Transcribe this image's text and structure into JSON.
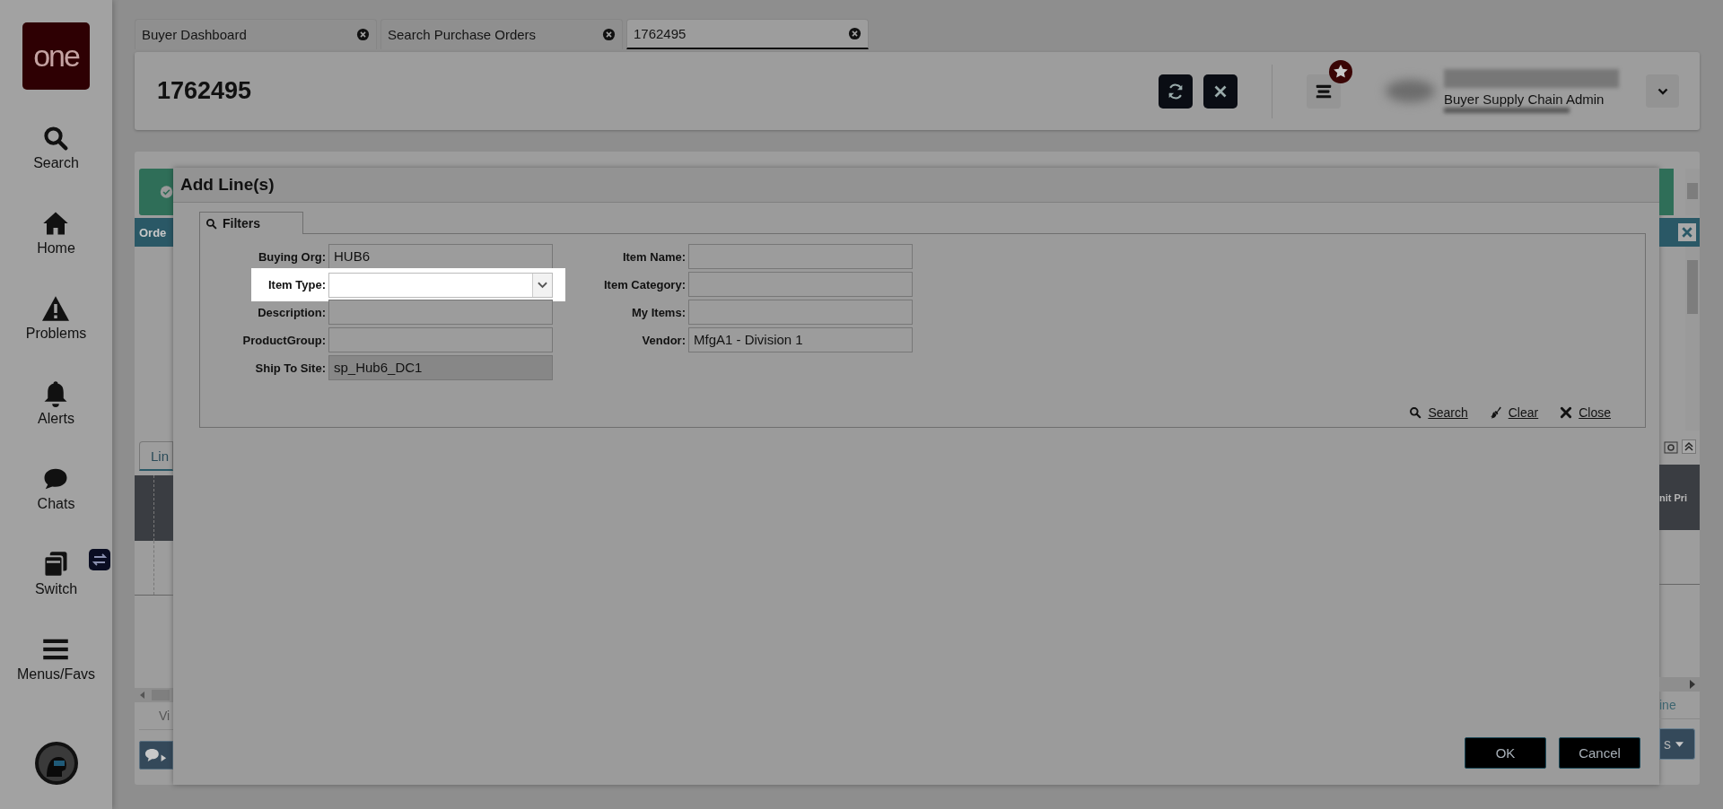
{
  "sidebar": {
    "logo": "one",
    "items": [
      {
        "kind": "search",
        "label": "Search"
      },
      {
        "kind": "home",
        "label": "Home"
      },
      {
        "kind": "problems",
        "label": "Problems"
      },
      {
        "kind": "alerts",
        "label": "Alerts"
      },
      {
        "kind": "chats",
        "label": "Chats"
      },
      {
        "kind": "switch",
        "label": "Switch"
      },
      {
        "kind": "menus",
        "label": "Menus/Favs"
      }
    ]
  },
  "tabs": [
    {
      "label": "Buyer Dashboard",
      "selected": false
    },
    {
      "label": "Search Purchase Orders",
      "selected": false
    },
    {
      "label": "1762495",
      "selected": true
    }
  ],
  "header": {
    "title": "1762495",
    "user_role": "Buyer Supply Chain Admin"
  },
  "page_behind": {
    "left": {
      "banner_title": "Orde",
      "tab": "Lin",
      "footer_text": "Vi"
    },
    "right": {
      "column_header": "nit Pri",
      "footer_text": "ine",
      "button": "s"
    }
  },
  "dialog": {
    "title": "Add Line(s)",
    "filter_tab": "Filters",
    "left_fields": [
      {
        "label": "Buying Org:",
        "value": "HUB6",
        "kind": "text",
        "highlighted": false
      },
      {
        "label": "Item Type:",
        "kind": "select",
        "highlighted": true
      },
      {
        "label": "Description:",
        "kind": "text",
        "highlighted": false
      },
      {
        "label": "ProductGroup:",
        "kind": "text",
        "highlighted": false
      },
      {
        "label": "Ship To Site:",
        "value": "sp_Hub6_DC1",
        "kind": "readonly",
        "highlighted": false
      }
    ],
    "right_fields": [
      {
        "label": "Item Name:",
        "kind": "text",
        "highlighted": false
      },
      {
        "label": "Item Category:",
        "kind": "text",
        "highlighted": false
      },
      {
        "label": "My Items:",
        "kind": "text",
        "highlighted": false
      },
      {
        "label": "Vendor:",
        "value": "MfgA1 - Division 1",
        "kind": "text",
        "highlighted": false
      }
    ],
    "links": [
      {
        "kind": "search",
        "label": "Search"
      },
      {
        "kind": "clear",
        "label": "Clear"
      },
      {
        "kind": "close",
        "label": "Close"
      }
    ],
    "buttons": [
      "OK",
      "Cancel"
    ]
  }
}
